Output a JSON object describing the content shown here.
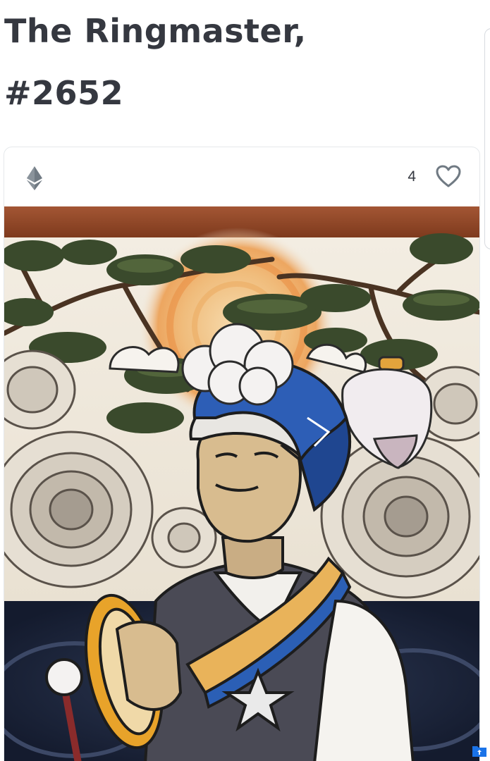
{
  "asset": {
    "title_line1": "The Ringmaster,",
    "title_line2": "#2652"
  },
  "card": {
    "chain_icon": "ethereum-icon",
    "favorite_count": "4",
    "favorite_icon": "heart-outline-icon",
    "image_subject": "illustrated man in blue and white tall hat holding a drum, in front of pine trees, sun and swirling clouds"
  },
  "colors": {
    "title_text": "#353840",
    "card_border": "#e5e8eb",
    "icon_gray": "#707a83",
    "art_top_band": "#9a4a2a"
  }
}
